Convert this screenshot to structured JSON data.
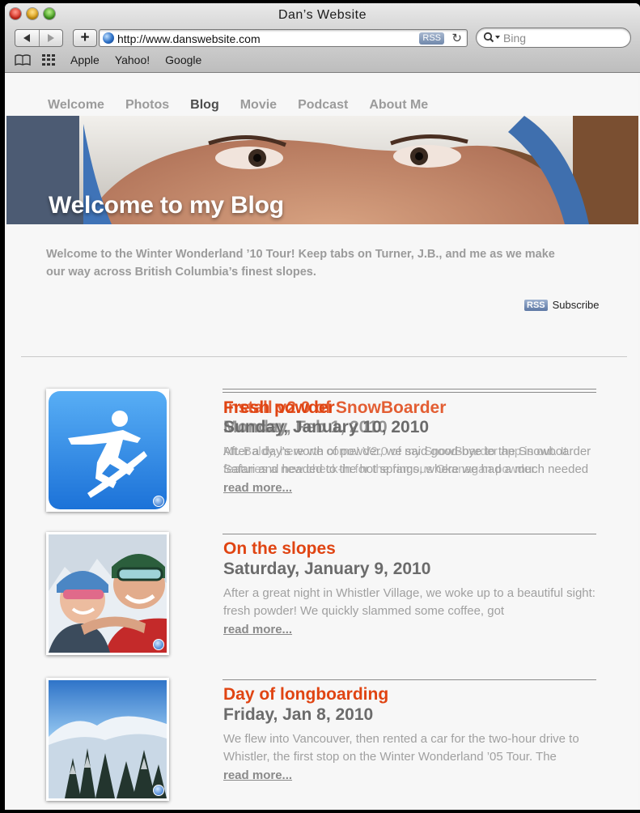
{
  "window": {
    "title": "Dan’s Website"
  },
  "toolbar": {
    "add_label": "+",
    "url": "http://www.danswebsite.com",
    "rss_label": "RSS",
    "search_placeholder": "Bing"
  },
  "bookmarks": [
    "Apple",
    "Yahoo!",
    "Google"
  ],
  "nav": {
    "items": [
      "Welcome",
      "Photos",
      "Blog",
      "Movie",
      "Podcast",
      "About Me"
    ],
    "active": "Blog"
  },
  "hero": {
    "title": "Welcome to my Blog"
  },
  "intro": "Welcome to the Winter Wonderland ’10 Tour! Keep tabs on Turner, J.B., and me as we make our way across British Columbia’s finest slopes.",
  "subscribe": {
    "badge": "RSS",
    "label": "Subscribe"
  },
  "posts": [
    {
      "title": "Fresh powder",
      "title_overlay": "Install v2.0 of SnowBoarder",
      "date": "Sunday, January 10, 2010",
      "date_overlay": "Monday, Feb 1, 2010",
      "excerpt": "After a day’s worth of powder, we said good-bye to the Snowboarder Safari and headed to the hot springs, where we had a much needed rest.",
      "excerpt_overlay": "Mt. Baldy, here we come! V2.0 of my SnowBoarder app is out. It features a new check-in for the famous Okanagan powder.",
      "read_more": "read more...",
      "thumb": "snowboarder-app-icon"
    },
    {
      "title": "On the slopes",
      "date": "Saturday, January 9, 2010",
      "excerpt": "After a great night in Whistler Village, we woke up to a beautiful sight: fresh powder! We quickly slammed some coffee, got",
      "read_more": "read more...",
      "thumb": "couple-photo"
    },
    {
      "title": "Day of longboarding",
      "date": "Friday, Jan 8, 2010",
      "excerpt": "We flew into Vancouver, then rented a car for the two-hour drive to Whistler, the first stop on the Winter Wonderland ’05 Tour. The",
      "read_more": "read more...",
      "thumb": "snowy-mountains-photo"
    }
  ],
  "colors": {
    "post_title": "#e04412",
    "nav_active": "#4d4d4d",
    "nav_inactive": "#9b9b9b"
  }
}
